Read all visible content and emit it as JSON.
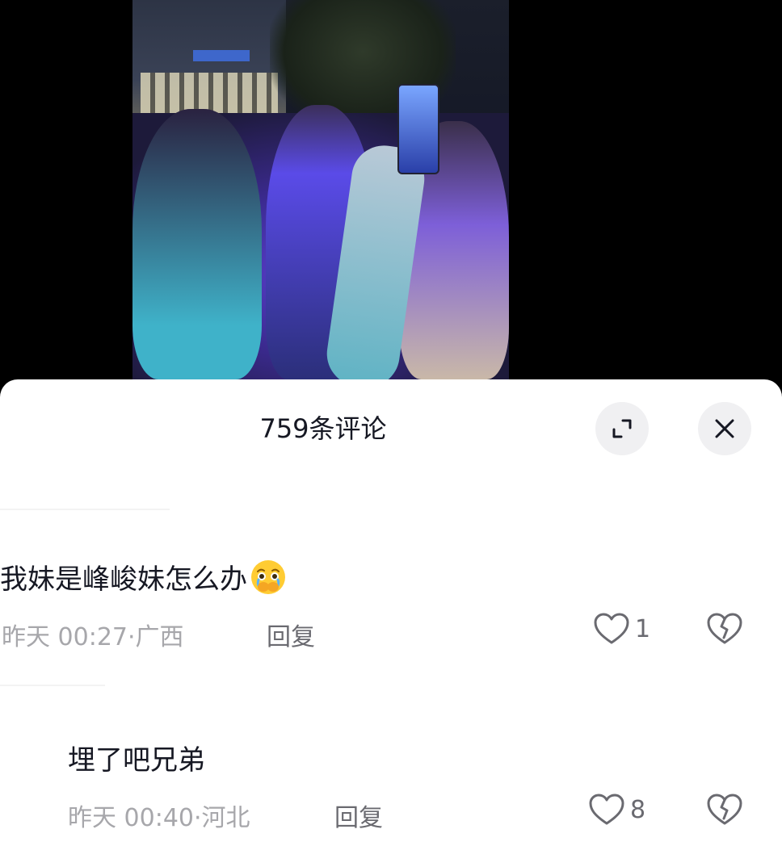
{
  "sheet": {
    "title": "759条评论"
  },
  "comments": [
    {
      "text": "我妹是峰峻妹怎么办",
      "emoji": "crying-pleading-face-emoji",
      "time": "昨天 00:27",
      "location": "广西",
      "meta_sep": "·",
      "reply_label": "回复",
      "likes": "1"
    },
    {
      "text": "埋了吧兄弟",
      "time": "昨天 00:40",
      "location": "河北",
      "meta_sep": "·",
      "reply_label": "回复",
      "likes": "8"
    }
  ],
  "icons": {
    "expand": "expand-icon",
    "close": "close-icon",
    "like": "heart-outline-icon",
    "dislike": "broken-heart-icon"
  },
  "colors": {
    "primary_text": "#161823",
    "secondary_text": "#a7a7ab",
    "icon": "#6a6a70",
    "button_bg": "#f0f0f2"
  }
}
